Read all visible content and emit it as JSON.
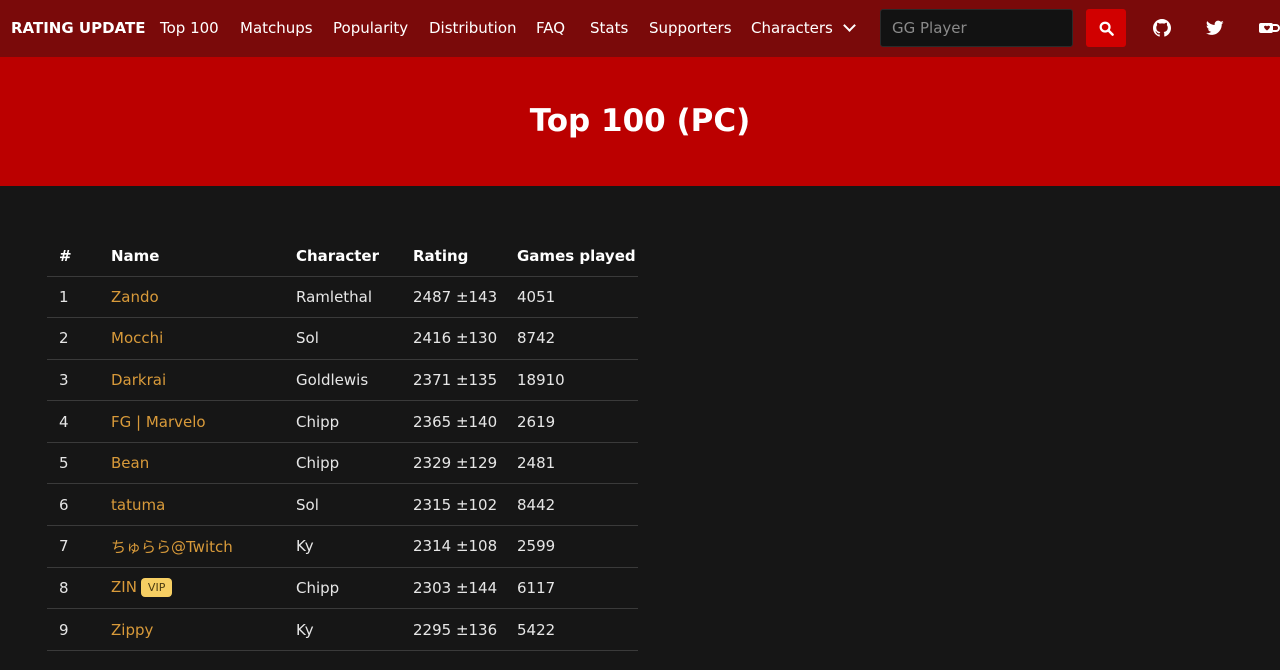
{
  "nav": {
    "brand": "RATING UPDATE",
    "links": [
      "Top 100",
      "Matchups",
      "Popularity",
      "Distribution",
      "FAQ",
      "Stats",
      "Supporters"
    ],
    "characters_label": "Characters",
    "search_placeholder": "GG Player",
    "icons": [
      "search-icon",
      "github-icon",
      "twitter-icon",
      "coffee-icon"
    ]
  },
  "hero": {
    "title": "Top 100 (PC)"
  },
  "table": {
    "headers": [
      "#",
      "Name",
      "Character",
      "Rating",
      "Games played"
    ],
    "rows": [
      {
        "rank": "1",
        "name": "Zando",
        "vip": "",
        "character": "Ramlethal",
        "rating": "2487 ±143",
        "games": "4051"
      },
      {
        "rank": "2",
        "name": "Mocchi",
        "vip": "",
        "character": "Sol",
        "rating": "2416 ±130",
        "games": "8742"
      },
      {
        "rank": "3",
        "name": "Darkrai",
        "vip": "",
        "character": "Goldlewis",
        "rating": "2371 ±135",
        "games": "18910"
      },
      {
        "rank": "4",
        "name": "FG | Marvelo",
        "vip": "",
        "character": "Chipp",
        "rating": "2365 ±140",
        "games": "2619"
      },
      {
        "rank": "5",
        "name": "Bean",
        "vip": "",
        "character": "Chipp",
        "rating": "2329 ±129",
        "games": "2481"
      },
      {
        "rank": "6",
        "name": "tatuma",
        "vip": "",
        "character": "Sol",
        "rating": "2315 ±102",
        "games": "8442"
      },
      {
        "rank": "7",
        "name": "ちゅらら@Twitch",
        "vip": "",
        "character": "Ky",
        "rating": "2314 ±108",
        "games": "2599"
      },
      {
        "rank": "8",
        "name": "ZIN",
        "vip": "VIP",
        "character": "Chipp",
        "rating": "2303 ±144",
        "games": "6117"
      },
      {
        "rank": "9",
        "name": "Zippy",
        "vip": "",
        "character": "Ky",
        "rating": "2295 ±136",
        "games": "5422"
      }
    ]
  },
  "colors": {
    "navbar": "#7a0a0a",
    "hero": "#bb0000",
    "background": "#161616",
    "search_button": "#d10000",
    "player_link": "#d89a3a",
    "vip_badge": "#f7cf63"
  }
}
